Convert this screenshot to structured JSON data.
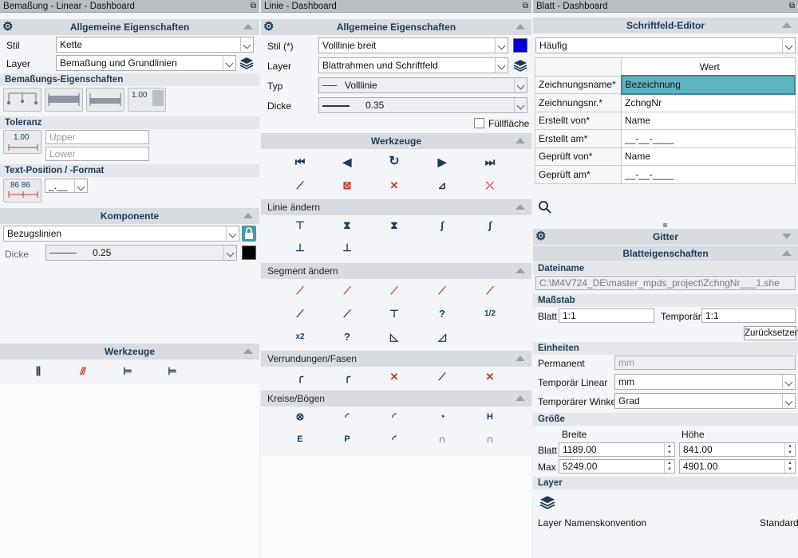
{
  "p1": {
    "title": "Bemaßung - Linear - Dashboard",
    "section_general": "Allgemeine Eigenschaften",
    "stil_label": "Stil",
    "stil_value": "Kette",
    "layer_label": "Layer",
    "layer_value": "Bemaßung und Grundlinien",
    "sub_dim": "Bemaßungs-Eigenschaften",
    "dim_btn_text": "1.00",
    "sub_tol": "Toleranz",
    "tol_btn_text": "1.00",
    "upper_ph": "Upper",
    "lower_ph": "Lower",
    "sub_textpos": "Text-Position / -Format",
    "textpos_btn_text": "86 86",
    "format_value": "_.__",
    "section_comp": "Komponente",
    "comp_value": "Bezugslinien",
    "dicke_label": "Dicke",
    "dicke_value": "0.25",
    "section_tools": "Werkzeuge"
  },
  "p2": {
    "title": "Linie - Dashboard",
    "section_general": "Allgemeine Eigenschaften",
    "stil_label": "Stil (*)",
    "stil_value": "Volllinie breit",
    "layer_label": "Layer",
    "layer_value": "Blattrahmen und Schriftfeld",
    "typ_label": "Typ",
    "typ_value": "Volllinie",
    "dicke_label": "Dicke",
    "dicke_value": "0.35",
    "fill_label": "Füllfläche",
    "section_tools": "Werkzeuge",
    "sec_line": "Linie ändern",
    "sec_segment": "Segment ändern",
    "sec_round": "Verrundungen/Fasen",
    "sec_arcs": "Kreise/Bögen",
    "seg_labels": [
      "x2",
      "?",
      "?",
      "1/2"
    ],
    "arc_labels": [
      "H",
      "E",
      "P"
    ]
  },
  "p3": {
    "title": "Blatt - Dashboard",
    "section_editor": "Schriftfeld-Editor",
    "filter_value": "Häufig",
    "col_header": "Wert",
    "rows": [
      {
        "k": "Zeichnungsname*",
        "v": "Bezeichnung"
      },
      {
        "k": "Zeichnungsnr.*",
        "v": "ZchngNr"
      },
      {
        "k": "Erstellt von*",
        "v": "Name"
      },
      {
        "k": "Erstellt am*",
        "v": "__-__-____"
      },
      {
        "k": "Geprüft von*",
        "v": "Name"
      },
      {
        "k": "Geprüft am*",
        "v": "__-__-____"
      }
    ],
    "section_grid": "Gitter",
    "section_sheet": "Blatteigenschaften",
    "sub_file": "Dateiname",
    "file_value": "C:\\M4V724_DE\\master_mpds_project\\ZchngNr___1.she",
    "sub_scale": "Maßstab",
    "blatt_label": "Blatt",
    "blatt_value": "1:1",
    "temp_label": "Temporär",
    "temp_value": "1:1",
    "reset_label": "Zurücksetzen",
    "sub_units": "Einheiten",
    "perm_label": "Permanent",
    "perm_value": "mm",
    "templin_label": "Temporär Linear",
    "templin_value": "mm",
    "tempang_label": "Temporärer Winkel",
    "tempang_value": "Grad",
    "sub_size": "Größe",
    "breite_label": "Breite",
    "hoehe_label": "Höhe",
    "size_blatt_label": "Blatt",
    "size_blatt_w": "1189.00",
    "size_blatt_h": "841.00",
    "size_max_label": "Max",
    "size_max_w": "5249.00",
    "size_max_h": "4901.00",
    "sub_layer": "Layer",
    "layer_conv_label": "Layer Namenskonvention",
    "layer_conv_value": "Standard"
  },
  "colors": {
    "accent": "#1b3a58",
    "selected": "#5eb3c1",
    "blue_swatch": "#0000d8",
    "black_swatch": "#000000",
    "tool_red": "#c0392b"
  }
}
